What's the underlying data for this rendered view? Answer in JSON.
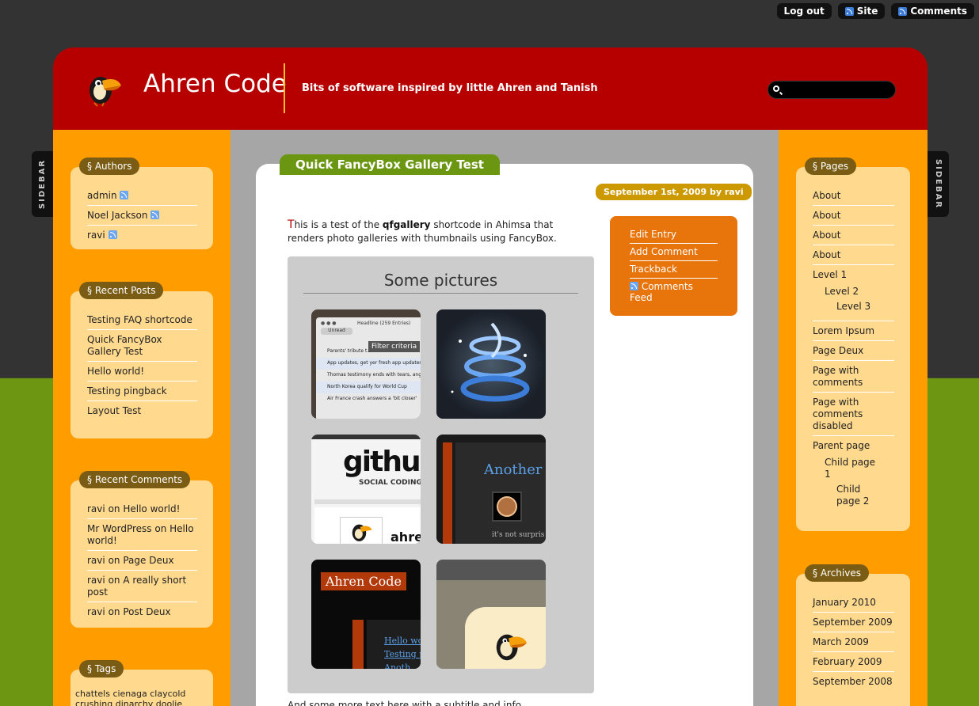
{
  "topbar": {
    "logout": "Log out",
    "site": "Site",
    "comments": "Comments"
  },
  "sidebar_tab_left": "SIDEBAR",
  "sidebar_tab_right": "SIDEBAR",
  "header": {
    "title": "Ahren Code",
    "tagline": "Bits of software inspired by little Ahren and Tanish",
    "search_placeholder": ""
  },
  "authors": {
    "title": "§ Authors",
    "items": [
      "admin",
      "Noel Jackson",
      "ravi"
    ]
  },
  "recent_posts": {
    "title": "§ Recent Posts",
    "items": [
      "Testing FAQ shortcode",
      "Quick FancyBox Gallery Test",
      "Hello world!",
      "Testing pingback",
      "Layout Test"
    ]
  },
  "recent_comments": {
    "title": "§ Recent Comments",
    "items": [
      {
        "author": "ravi",
        "on": "on",
        "post": "Hello world!"
      },
      {
        "author": "Mr WordPress",
        "on": "on",
        "post": "Hello world!"
      },
      {
        "author": "ravi",
        "on": "on",
        "post": "Page Deux"
      },
      {
        "author": "ravi",
        "on": "on",
        "post": "A really short post"
      },
      {
        "author": "ravi",
        "on": "on",
        "post": "Post Deux"
      }
    ]
  },
  "tags": {
    "title": "§ Tags",
    "text": "chattels cienaga claycold crushing dinarchy doolie"
  },
  "post": {
    "title": "Quick FancyBox Gallery Test",
    "meta": "September 1st, 2009 by ravi",
    "intro_first": "T",
    "intro_a": "his is a test of the ",
    "intro_code": "qfgallery",
    "intro_b": " shortcode in Ahimsa that renders photo galleries with thumbnails using FancyBox.",
    "gallery_title": "Some pictures",
    "bottom_text": "And some more text here with a subtitle and info ..."
  },
  "actions": {
    "edit": "Edit Entry",
    "add_comment": "Add Comment",
    "trackback": "Trackback",
    "feed": "Comments Feed"
  },
  "thumbs": {
    "t1": {
      "headline": "Headline (259 Entries)",
      "filter": "Filter criteria",
      "unread": "Unread",
      "items": [
        "Parents' tribute t...",
        "App updates, get yer fresh app updates",
        "Thomas testimony ends with tears, ange",
        "North Korea qualify for World Cup",
        "Air France crash answers a 'bit closer'"
      ]
    },
    "t3": {
      "logo": "github",
      "sub": "SOCIAL CODING",
      "name": "ahre"
    },
    "t4": {
      "text": "Another t",
      "small": "it's not surpris"
    },
    "t5": {
      "brand": "Ahren Code",
      "link1": "Hello wo",
      "link2": "Testing p",
      "link3": "Anoth"
    }
  },
  "pages": {
    "title": "§ Pages",
    "items": [
      {
        "label": "About",
        "level": 0
      },
      {
        "label": "About",
        "level": 0
      },
      {
        "label": "About",
        "level": 0
      },
      {
        "label": "About",
        "level": 0
      },
      {
        "label": "Level 1",
        "level": 0
      },
      {
        "label": "Level 2",
        "level": 1
      },
      {
        "label": "Level 3",
        "level": 2
      },
      {
        "label": "Lorem Ipsum",
        "level": 0
      },
      {
        "label": "Page Deux",
        "level": 0
      },
      {
        "label": "Page with comments",
        "level": 0
      },
      {
        "label": "Page with comments disabled",
        "level": 0
      },
      {
        "label": "Parent page",
        "level": 0
      },
      {
        "label": "Child page 1",
        "level": 1
      },
      {
        "label": "Child page 2",
        "level": 2
      }
    ]
  },
  "archives": {
    "title": "§ Archives",
    "items": [
      "January 2010",
      "September 2009",
      "March 2009",
      "February 2009",
      "September 2008"
    ]
  }
}
